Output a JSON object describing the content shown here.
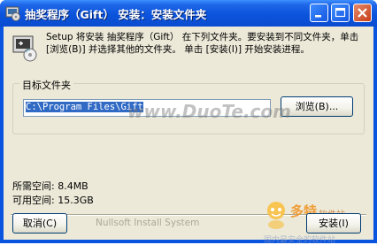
{
  "window": {
    "title": "抽奖程序（Gift） 安装：安装文件夹"
  },
  "intro": {
    "text": "Setup 将安装 抽奖程序（Gift） 在下列文件夹。要安装到不同文件夹，单击 [浏览(B)] 并选择其他的文件夹。 单击 [安装(I)] 开始安装进程。"
  },
  "dest": {
    "group_label": "目标文件夹",
    "path": "C:\\Program Files\\Gift",
    "browse_label": "浏览(B)..."
  },
  "space": {
    "required": "所需空间: 8.4MB",
    "available": "可用空间: 15.3GB"
  },
  "footer": {
    "brand": "Nullsoft Install System",
    "cancel_label": "取消(C)",
    "install_label": "安装(I)"
  },
  "watermarks": {
    "duote_url": "www.DuoTe.com",
    "brand_big": "多特",
    "brand_small": "软件站",
    "brand_sub": "国内最安全的软件站"
  },
  "colors": {
    "titlebar": "#0B54DC",
    "close_button": "#C73E17",
    "client_bg": "#ECE9D8",
    "selection": "#316AC5"
  },
  "icons": {
    "title": "installer-icon",
    "setup": "installer-disk-icon",
    "minimize": "minimize-icon",
    "maximize": "maximize-icon",
    "close": "close-icon"
  }
}
